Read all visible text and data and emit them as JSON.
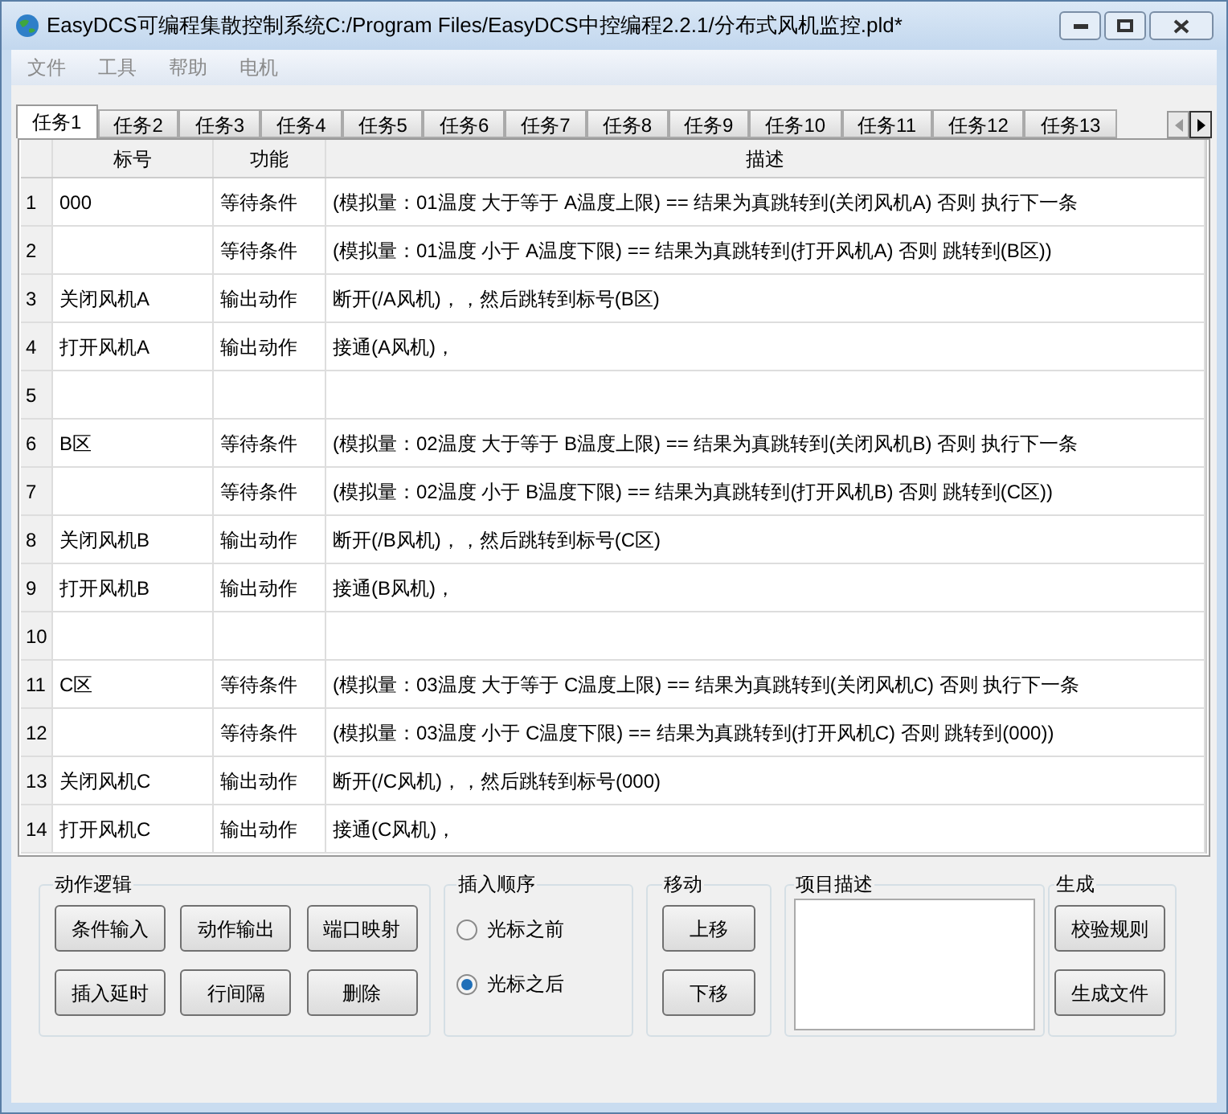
{
  "window": {
    "title": "EasyDCS可编程集散控制系统C:/Program Files/EasyDCS中控编程2.2.1/分布式风机监控.pld*"
  },
  "menu": [
    "文件",
    "工具",
    "帮助",
    "电机"
  ],
  "tabs": [
    {
      "label": "任务1",
      "selected": true
    },
    {
      "label": "任务2",
      "selected": false
    },
    {
      "label": "任务3",
      "selected": false
    },
    {
      "label": "任务4",
      "selected": false
    },
    {
      "label": "任务5",
      "selected": false
    },
    {
      "label": "任务6",
      "selected": false
    },
    {
      "label": "任务7",
      "selected": false
    },
    {
      "label": "任务8",
      "selected": false
    },
    {
      "label": "任务9",
      "selected": false
    },
    {
      "label": "任务10",
      "selected": false
    },
    {
      "label": "任务11",
      "selected": false
    },
    {
      "label": "任务12",
      "selected": false
    },
    {
      "label": "任务13",
      "selected": false
    }
  ],
  "table": {
    "columns": [
      "标号",
      "功能",
      "描述"
    ],
    "rows": [
      {
        "num": "1",
        "label": "000",
        "function": "等待条件",
        "description": "(模拟量：01温度 大于等于 A温度上限) == 结果为真跳转到(关闭风机A)  否则 执行下一条"
      },
      {
        "num": "2",
        "label": "",
        "function": "等待条件",
        "description": "(模拟量：01温度 小于 A温度下限) == 结果为真跳转到(打开风机A)  否则 跳转到(B区))"
      },
      {
        "num": "3",
        "label": "关闭风机A",
        "function": "输出动作",
        "description": "断开(/A风机)，，然后跳转到标号(B区)"
      },
      {
        "num": "4",
        "label": "打开风机A",
        "function": "输出动作",
        "description": "接通(A风机)，"
      },
      {
        "num": "5",
        "label": "",
        "function": "",
        "description": ""
      },
      {
        "num": "6",
        "label": "B区",
        "function": "等待条件",
        "description": "(模拟量：02温度 大于等于 B温度上限) == 结果为真跳转到(关闭风机B)  否则 执行下一条"
      },
      {
        "num": "7",
        "label": "",
        "function": "等待条件",
        "description": "(模拟量：02温度 小于 B温度下限) == 结果为真跳转到(打开风机B)  否则 跳转到(C区))"
      },
      {
        "num": "8",
        "label": "关闭风机B",
        "function": "输出动作",
        "description": "断开(/B风机)，，然后跳转到标号(C区)"
      },
      {
        "num": "9",
        "label": "打开风机B",
        "function": "输出动作",
        "description": "接通(B风机)，"
      },
      {
        "num": "10",
        "label": "",
        "function": "",
        "description": ""
      },
      {
        "num": "11",
        "label": "C区",
        "function": "等待条件",
        "description": "(模拟量：03温度 大于等于 C温度上限) == 结果为真跳转到(关闭风机C)  否则 执行下一条"
      },
      {
        "num": "12",
        "label": "",
        "function": "等待条件",
        "description": "(模拟量：03温度 小于 C温度下限) == 结果为真跳转到(打开风机C)  否则 跳转到(000))"
      },
      {
        "num": "13",
        "label": "关闭风机C",
        "function": "输出动作",
        "description": "断开(/C风机)，，然后跳转到标号(000)"
      },
      {
        "num": "14",
        "label": "打开风机C",
        "function": "输出动作",
        "description": "接通(C风机)，"
      }
    ]
  },
  "action_logic": {
    "title": "动作逻辑",
    "buttons": [
      "条件输入",
      "动作输出",
      "端口映射",
      "插入延时",
      "行间隔",
      "删除"
    ]
  },
  "insert_order": {
    "title": "插入顺序",
    "options": [
      {
        "label": "光标之前",
        "selected": false
      },
      {
        "label": "光标之后",
        "selected": true
      }
    ]
  },
  "move": {
    "title": "移动",
    "buttons": [
      "上移",
      "下移"
    ]
  },
  "item_description": {
    "title": "项目描述"
  },
  "generate": {
    "title": "生成",
    "buttons": [
      "校验规则",
      "生成文件"
    ]
  }
}
